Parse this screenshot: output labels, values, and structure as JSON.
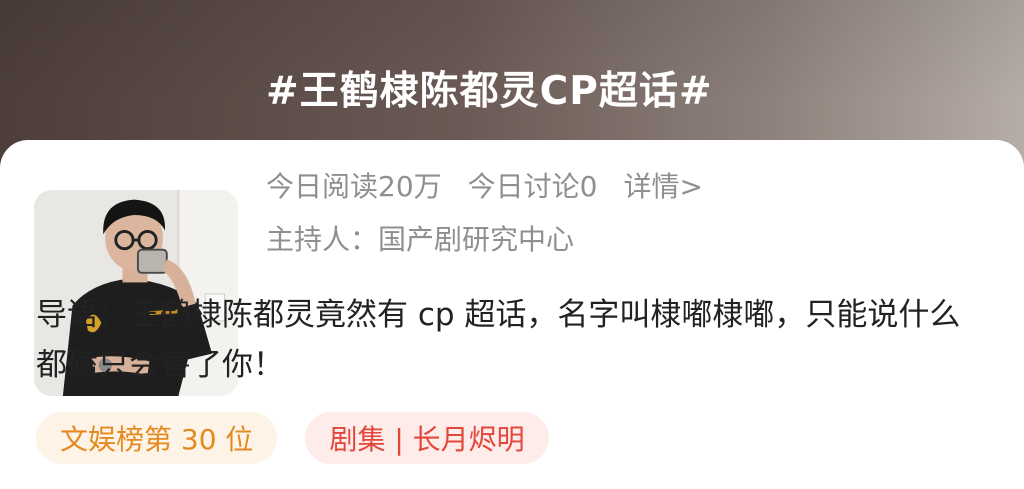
{
  "header": {
    "title": "#王鹤棣陈都灵CP超话#"
  },
  "stats": {
    "reads": "今日阅读20万",
    "discussions": "今日讨论0",
    "details_link": "详情>"
  },
  "host": {
    "label": "主持人：国产剧研究中心"
  },
  "intro": {
    "text": "导语：王鹤棣陈都灵竟然有 cp 超话，名字叫棣嘟棣嘟，只能说什么都磕只会害了你！"
  },
  "tags": [
    {
      "label": "文娱榜第 30 位",
      "color": "#e58a21",
      "bg": "#fdf3e6"
    },
    {
      "label": "剧集 | 长月烬明",
      "color": "#e2473b",
      "bg": "#fdecea"
    }
  ],
  "colors": {
    "banner_dark": "#4d3e39",
    "banner_light": "#b6ada6",
    "muted_text": "#8f8f8f",
    "body_text": "#222222"
  },
  "avatar": {
    "icon": "user-photo-icon"
  }
}
